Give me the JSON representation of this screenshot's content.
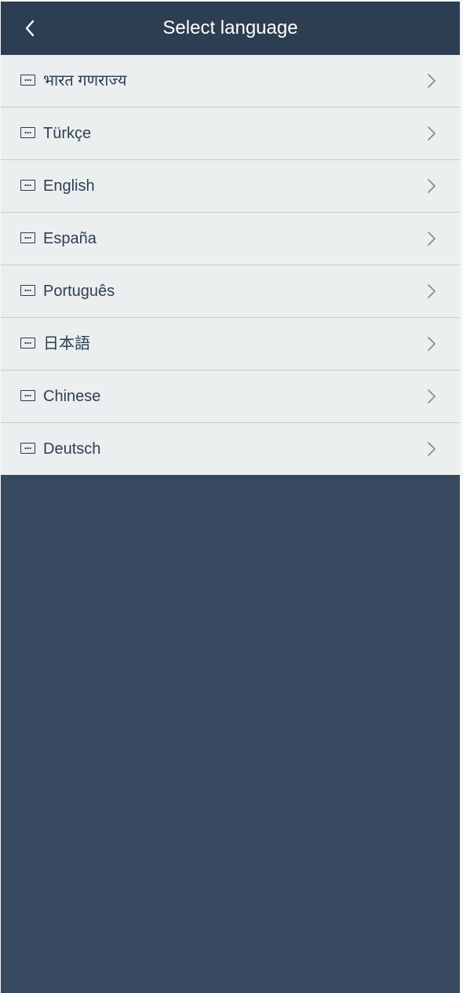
{
  "header": {
    "title": "Select language",
    "back_icon": "chevron-left-icon"
  },
  "languages": [
    {
      "label": "भारत गणराज्य",
      "icon": "keyboard-icon",
      "chevron": "chevron-right-icon"
    },
    {
      "label": "Türkçe",
      "icon": "keyboard-icon",
      "chevron": "chevron-right-icon"
    },
    {
      "label": "English",
      "icon": "keyboard-icon",
      "chevron": "chevron-right-icon"
    },
    {
      "label": "España",
      "icon": "keyboard-icon",
      "chevron": "chevron-right-icon"
    },
    {
      "label": "Português",
      "icon": "keyboard-icon",
      "chevron": "chevron-right-icon"
    },
    {
      "label": "日本語",
      "icon": "keyboard-icon",
      "chevron": "chevron-right-icon"
    },
    {
      "label": "Chinese",
      "icon": "keyboard-icon",
      "chevron": "chevron-right-icon"
    },
    {
      "label": "Deutsch",
      "icon": "keyboard-icon",
      "chevron": "chevron-right-icon"
    }
  ],
  "colors": {
    "header_bg": "#2d3e52",
    "page_bg": "#36495e",
    "list_bg": "#ebeff0",
    "text": "#2e3f51",
    "divider": "#c7cbce"
  }
}
